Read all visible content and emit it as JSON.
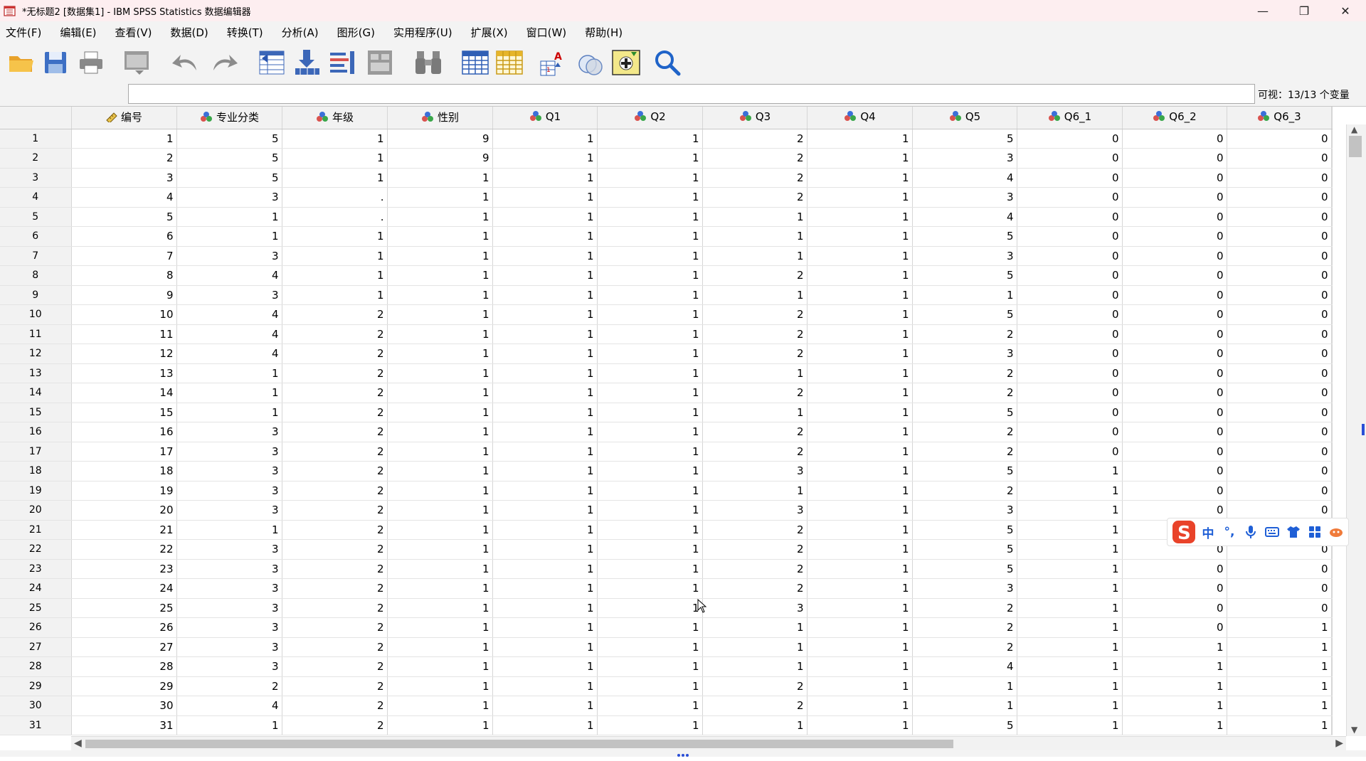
{
  "window": {
    "title": "*无标题2 [数据集1] - IBM SPSS Statistics 数据编辑器",
    "controls": [
      "minimize",
      "restore",
      "close"
    ]
  },
  "menu": [
    "文件(F)",
    "编辑(E)",
    "查看(V)",
    "数据(D)",
    "转换(T)",
    "分析(A)",
    "图形(G)",
    "实用程序(U)",
    "扩展(X)",
    "窗口(W)",
    "帮助(H)"
  ],
  "toolbar": {
    "buttons": [
      "open-folder-icon",
      "save-icon",
      "print-icon",
      "dialog-recall-icon",
      "undo-icon",
      "redo-icon",
      "go-to-case-icon",
      "go-to-variable-icon",
      "variables-icon",
      "run-descriptives-icon",
      "find-icon",
      "insert-cases-icon",
      "insert-variable-icon",
      "split-file-icon",
      "select-cases-icon",
      "value-labels-icon",
      "add-icon",
      "search-icon"
    ]
  },
  "formula_bar": {
    "value": "",
    "visible_label": "可视：13/13 个变量"
  },
  "grid": {
    "columns": [
      {
        "name": "编号",
        "icon": "scale-ruler-icon"
      },
      {
        "name": "专业分类",
        "icon": "nominal-icon"
      },
      {
        "name": "年级",
        "icon": "nominal-icon"
      },
      {
        "name": "性别",
        "icon": "nominal-icon"
      },
      {
        "name": "Q1",
        "icon": "nominal-icon"
      },
      {
        "name": "Q2",
        "icon": "nominal-icon"
      },
      {
        "name": "Q3",
        "icon": "nominal-icon"
      },
      {
        "name": "Q4",
        "icon": "nominal-icon"
      },
      {
        "name": "Q5",
        "icon": "nominal-icon"
      },
      {
        "name": "Q6_1",
        "icon": "nominal-icon"
      },
      {
        "name": "Q6_2",
        "icon": "nominal-icon"
      },
      {
        "name": "Q6_3",
        "icon": "nominal-icon"
      }
    ],
    "rows": [
      [
        "1",
        "1",
        "5",
        "1",
        "9",
        "1",
        "1",
        "2",
        "1",
        "5",
        "0",
        "0",
        "0"
      ],
      [
        "2",
        "2",
        "5",
        "1",
        "9",
        "1",
        "1",
        "2",
        "1",
        "3",
        "0",
        "0",
        "0"
      ],
      [
        "3",
        "3",
        "5",
        "1",
        "1",
        "1",
        "1",
        "2",
        "1",
        "4",
        "0",
        "0",
        "0"
      ],
      [
        "4",
        "4",
        "3",
        ".",
        "1",
        "1",
        "1",
        "2",
        "1",
        "3",
        "0",
        "0",
        "0"
      ],
      [
        "5",
        "5",
        "1",
        ".",
        "1",
        "1",
        "1",
        "1",
        "1",
        "4",
        "0",
        "0",
        "0"
      ],
      [
        "6",
        "6",
        "1",
        "1",
        "1",
        "1",
        "1",
        "1",
        "1",
        "5",
        "0",
        "0",
        "0"
      ],
      [
        "7",
        "7",
        "3",
        "1",
        "1",
        "1",
        "1",
        "1",
        "1",
        "3",
        "0",
        "0",
        "0"
      ],
      [
        "8",
        "8",
        "4",
        "1",
        "1",
        "1",
        "1",
        "2",
        "1",
        "5",
        "0",
        "0",
        "0"
      ],
      [
        "9",
        "9",
        "3",
        "1",
        "1",
        "1",
        "1",
        "1",
        "1",
        "1",
        "0",
        "0",
        "0"
      ],
      [
        "10",
        "10",
        "4",
        "2",
        "1",
        "1",
        "1",
        "2",
        "1",
        "5",
        "0",
        "0",
        "0"
      ],
      [
        "11",
        "11",
        "4",
        "2",
        "1",
        "1",
        "1",
        "2",
        "1",
        "2",
        "0",
        "0",
        "0"
      ],
      [
        "12",
        "12",
        "4",
        "2",
        "1",
        "1",
        "1",
        "2",
        "1",
        "3",
        "0",
        "0",
        "0"
      ],
      [
        "13",
        "13",
        "1",
        "2",
        "1",
        "1",
        "1",
        "1",
        "1",
        "2",
        "0",
        "0",
        "0"
      ],
      [
        "14",
        "14",
        "1",
        "2",
        "1",
        "1",
        "1",
        "2",
        "1",
        "2",
        "0",
        "0",
        "0"
      ],
      [
        "15",
        "15",
        "1",
        "2",
        "1",
        "1",
        "1",
        "1",
        "1",
        "5",
        "0",
        "0",
        "0"
      ],
      [
        "16",
        "16",
        "3",
        "2",
        "1",
        "1",
        "1",
        "2",
        "1",
        "2",
        "0",
        "0",
        "0"
      ],
      [
        "17",
        "17",
        "3",
        "2",
        "1",
        "1",
        "1",
        "2",
        "1",
        "2",
        "0",
        "0",
        "0"
      ],
      [
        "18",
        "18",
        "3",
        "2",
        "1",
        "1",
        "1",
        "3",
        "1",
        "5",
        "1",
        "0",
        "0"
      ],
      [
        "19",
        "19",
        "3",
        "2",
        "1",
        "1",
        "1",
        "1",
        "1",
        "2",
        "1",
        "0",
        "0"
      ],
      [
        "20",
        "20",
        "3",
        "2",
        "1",
        "1",
        "1",
        "3",
        "1",
        "3",
        "1",
        "0",
        "0"
      ],
      [
        "21",
        "21",
        "1",
        "2",
        "1",
        "1",
        "1",
        "2",
        "1",
        "5",
        "1",
        "",
        ""
      ],
      [
        "22",
        "22",
        "3",
        "2",
        "1",
        "1",
        "1",
        "2",
        "1",
        "5",
        "1",
        "0",
        "0"
      ],
      [
        "23",
        "23",
        "3",
        "2",
        "1",
        "1",
        "1",
        "2",
        "1",
        "5",
        "1",
        "0",
        "0"
      ],
      [
        "24",
        "24",
        "3",
        "2",
        "1",
        "1",
        "1",
        "2",
        "1",
        "3",
        "1",
        "0",
        "0"
      ],
      [
        "25",
        "25",
        "3",
        "2",
        "1",
        "1",
        "1",
        "3",
        "1",
        "2",
        "1",
        "0",
        "0"
      ],
      [
        "26",
        "26",
        "3",
        "2",
        "1",
        "1",
        "1",
        "1",
        "1",
        "2",
        "1",
        "0",
        "1"
      ],
      [
        "27",
        "27",
        "3",
        "2",
        "1",
        "1",
        "1",
        "1",
        "1",
        "2",
        "1",
        "1",
        "1"
      ],
      [
        "28",
        "28",
        "3",
        "2",
        "1",
        "1",
        "1",
        "1",
        "1",
        "4",
        "1",
        "1",
        "1"
      ],
      [
        "29",
        "29",
        "2",
        "2",
        "1",
        "1",
        "1",
        "2",
        "1",
        "1",
        "1",
        "1",
        "1"
      ],
      [
        "30",
        "30",
        "4",
        "2",
        "1",
        "1",
        "1",
        "2",
        "1",
        "1",
        "1",
        "1",
        "1"
      ],
      [
        "31",
        "31",
        "1",
        "2",
        "1",
        "1",
        "1",
        "1",
        "1",
        "5",
        "1",
        "1",
        "1"
      ]
    ]
  },
  "ime_toolbar": {
    "items": [
      "中",
      "°,",
      "microphone-icon",
      "keyboard-icon",
      "skin-icon",
      "apps-icon",
      "tools-icon"
    ]
  },
  "colors": {
    "title_bg": "#fdeef0",
    "chrome_bg": "#f3f3f3",
    "header_bg": "#f2f2f2",
    "nominal_red": "#d9534f",
    "nominal_blue": "#3b6fd8",
    "nominal_green": "#3aa64a"
  }
}
